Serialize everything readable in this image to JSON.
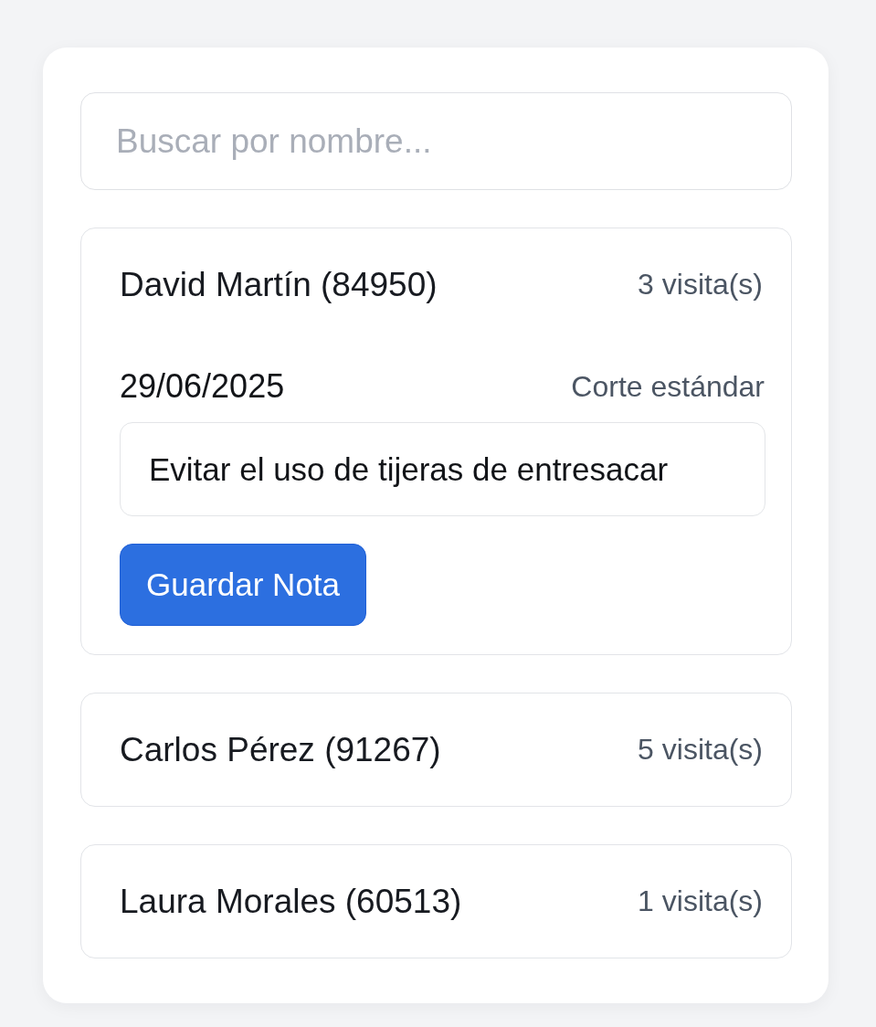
{
  "search": {
    "placeholder": "Buscar por nombre..."
  },
  "clients": [
    {
      "name": "David Martín (84950)",
      "visits": "3 visita(s)",
      "expanded": true,
      "history": [
        {
          "date": "29/06/2025",
          "service": "Corte estándar",
          "note": "Evitar el uso de tijeras de entresacar"
        }
      ],
      "action": "Guardar Nota"
    },
    {
      "name": "Carlos Pérez (91267)",
      "visits": "5 visita(s)",
      "expanded": false
    },
    {
      "name": "Laura Morales (60513)",
      "visits": "1 visita(s)",
      "expanded": false
    }
  ]
}
